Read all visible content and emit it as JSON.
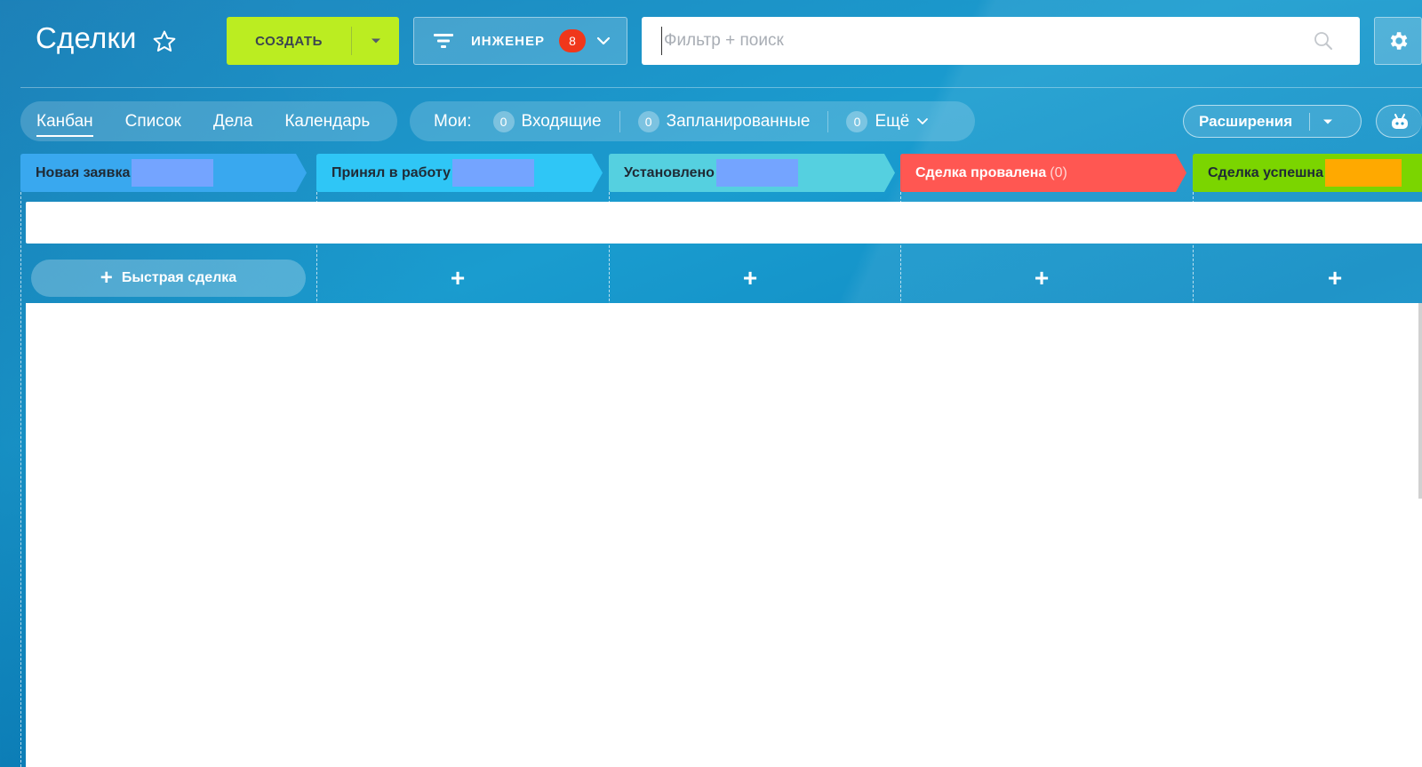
{
  "header": {
    "title": "Сделки",
    "create_label": "СОЗДАТЬ",
    "filter_label": "ИНЖЕНЕР",
    "filter_counter": "8",
    "search_placeholder": "Фильтр + поиск"
  },
  "view_tabs": [
    {
      "label": "Канбан",
      "active": true
    },
    {
      "label": "Список",
      "active": false
    },
    {
      "label": "Дела",
      "active": false
    },
    {
      "label": "Календарь",
      "active": false
    }
  ],
  "counters": {
    "mine_label": "Мои:",
    "items": [
      {
        "count": "0",
        "label": "Входящие"
      },
      {
        "count": "0",
        "label": "Запланированные"
      },
      {
        "count": "0",
        "label": "Ещё"
      }
    ]
  },
  "extensions_label": "Расширения",
  "stages": [
    {
      "name": "Новая заявка",
      "count": "",
      "color": "#39a8ef",
      "redact_color": "#74a4ff"
    },
    {
      "name": "Принял в работу",
      "count": "",
      "color": "#2fc6f6",
      "redact_color": "#74a4ff"
    },
    {
      "name": "Установлено",
      "count": "",
      "color": "#55d0e0",
      "redact_color": "#74a4ff"
    },
    {
      "name": "Сделка провалена",
      "count": "(0)",
      "color": "#ff5752",
      "redact_color": ""
    },
    {
      "name": "Сделка успешна",
      "count": "",
      "color": "#7bd500",
      "redact_color": "#ffa900"
    }
  ],
  "quick_deal_label": "Быстрая сделка",
  "icons": {
    "star": "star-icon",
    "filter": "filter-icon",
    "search": "search-icon",
    "settings": "gear-icon",
    "robot": "robot-icon"
  }
}
